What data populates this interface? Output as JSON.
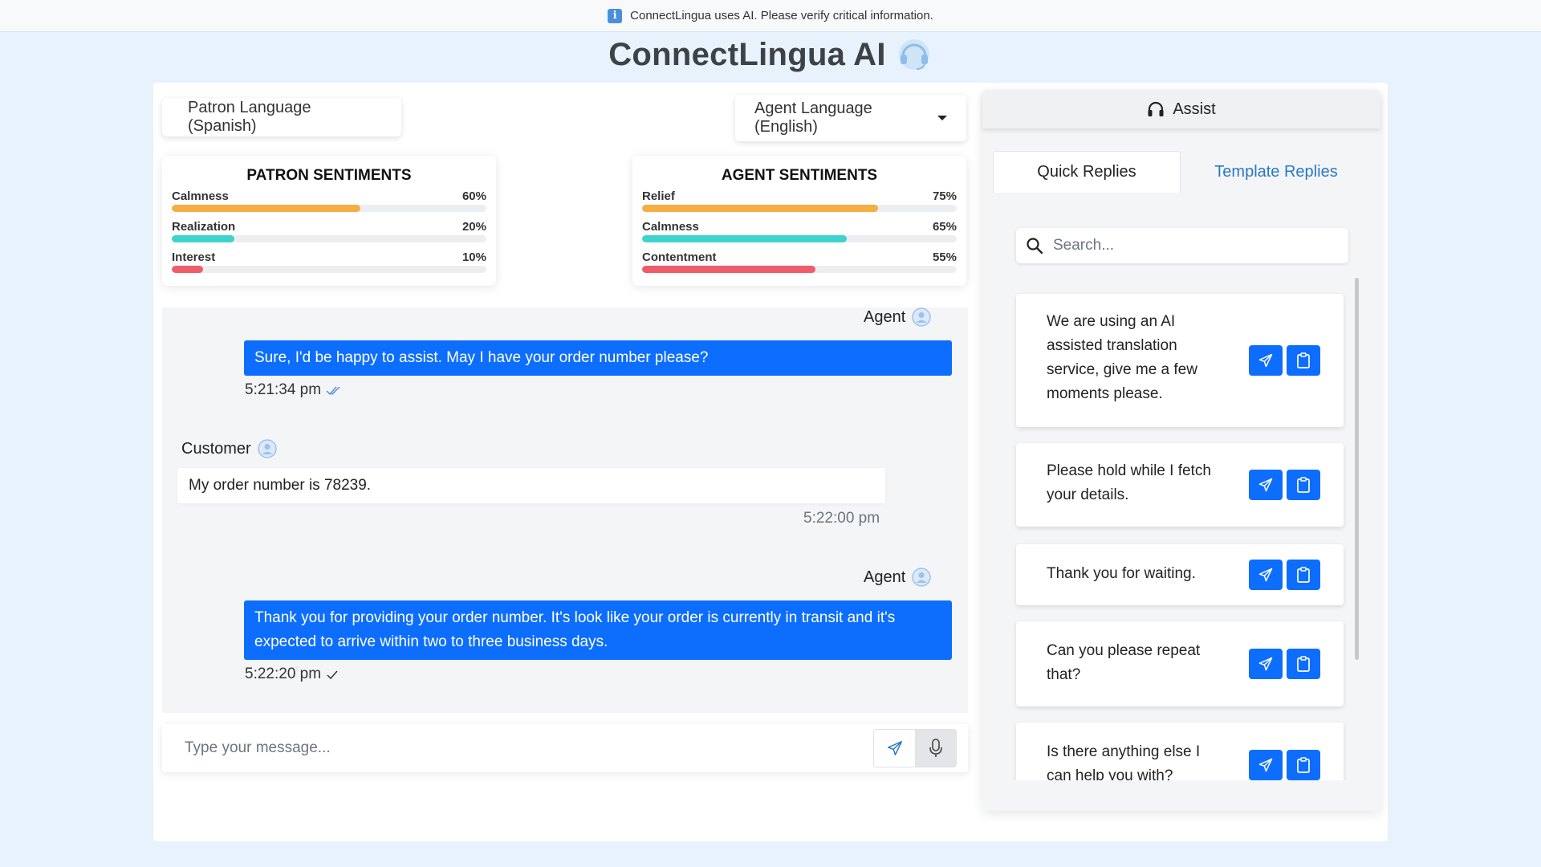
{
  "banner": {
    "text": "ConnectLingua uses AI. Please verify critical information."
  },
  "app": {
    "title": "ConnectLingua AI"
  },
  "languages": {
    "patron": "Patron Language (Spanish)",
    "agent": "Agent Language (English)"
  },
  "patron_sentiments": {
    "title": "PATRON SENTIMENTS",
    "items": [
      {
        "label": "Calmness",
        "value": "60%",
        "fraction": 0.6,
        "color": "#f6ad42"
      },
      {
        "label": "Realization",
        "value": "20%",
        "fraction": 0.2,
        "color": "#3ed3cc"
      },
      {
        "label": "Interest",
        "value": "10%",
        "fraction": 0.1,
        "color": "#ef5c6a"
      }
    ]
  },
  "agent_sentiments": {
    "title": "AGENT SENTIMENTS",
    "items": [
      {
        "label": "Relief",
        "value": "75%",
        "fraction": 0.75,
        "color": "#f6ad42"
      },
      {
        "label": "Calmness",
        "value": "65%",
        "fraction": 0.65,
        "color": "#3ed3cc"
      },
      {
        "label": "Contentment",
        "value": "55%",
        "fraction": 0.55,
        "color": "#ef5c6a"
      }
    ]
  },
  "chat": {
    "messages": [
      {
        "sender": "Agent",
        "text": "Sure, I'd be happy to assist. May I have your order number please?",
        "time": "5:21:34 pm",
        "status": "read"
      },
      {
        "sender": "Customer",
        "text": "My order number is 78239.",
        "time": "5:22:00 pm"
      },
      {
        "sender": "Agent",
        "text": "Thank you for providing your order number. It's look like your order is currently in transit and it's expected to arrive within two to three business days.",
        "time": "5:22:20 pm",
        "status": "sent"
      }
    ]
  },
  "composer": {
    "placeholder": "Type your message..."
  },
  "assist": {
    "title": "Assist",
    "tabs": [
      "Quick Replies",
      "Template Replies"
    ],
    "active_tab": "Quick Replies",
    "search_placeholder": "Search...",
    "quick_replies": [
      "We are using an AI assisted translation service, give me a few moments please.",
      "Please hold while I fetch your details.",
      "Thank you for waiting.",
      "Can you please repeat that?",
      "Is there anything else I can help you with?"
    ]
  },
  "colors": {
    "primary": "#0d6efd",
    "link": "#2a78c7",
    "page_bg": "#e8f2fc"
  }
}
